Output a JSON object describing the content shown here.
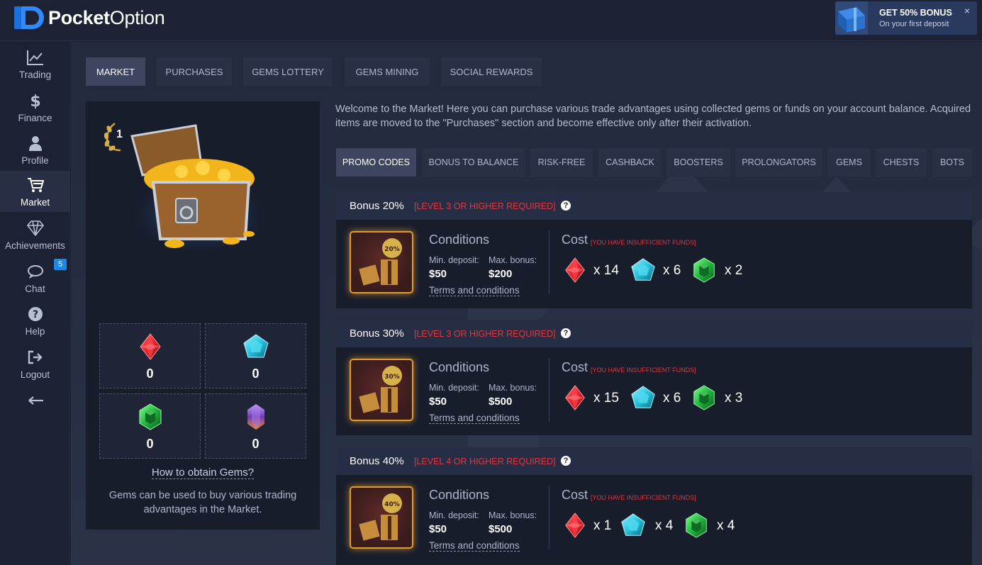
{
  "header": {
    "logo_bold": "Pocket",
    "logo_thin": "Option",
    "bonus_title": "GET 50% BONUS",
    "bonus_subtitle": "On your first deposit",
    "bonus_close": "×"
  },
  "sidebar": {
    "items": [
      {
        "label": "Trading",
        "icon": "chart-icon"
      },
      {
        "label": "Finance",
        "icon": "dollar-icon"
      },
      {
        "label": "Profile",
        "icon": "user-icon"
      },
      {
        "label": "Market",
        "icon": "cart-icon",
        "active": true
      },
      {
        "label": "Achievements",
        "icon": "diamond-icon"
      },
      {
        "label": "Chat",
        "icon": "chat-icon",
        "badge": "5"
      },
      {
        "label": "Help",
        "icon": "question-icon"
      },
      {
        "label": "Logout",
        "icon": "logout-icon"
      }
    ],
    "collapse_arrow": "⟵"
  },
  "top_tabs": [
    "MARKET",
    "PURCHASES",
    "GEMS LOTTERY",
    "GEMS MINING",
    "SOCIAL REWARDS"
  ],
  "left_panel": {
    "level": "1",
    "gems": [
      {
        "type": "red-gem",
        "count": "0"
      },
      {
        "type": "blue-gem",
        "count": "0"
      },
      {
        "type": "green-gem",
        "count": "0"
      },
      {
        "type": "purple-gem",
        "count": "0"
      }
    ],
    "obtain_link": "How to obtain Gems?",
    "description": "Gems can be used to buy various trading advantages in the Market."
  },
  "welcome_text": "Welcome to the Market! Here you can purchase various trade advantages using collected gems or funds on your account balance. Acquired items are moved to the \"Purchases\" section and become effective only after their activation.",
  "sub_tabs": [
    "PROMO CODES",
    "BONUS TO BALANCE",
    "RISK-FREE",
    "CASHBACK",
    "BOOSTERS",
    "PROLONGATORS",
    "GEMS",
    "CHESTS",
    "BOTS"
  ],
  "offers": [
    {
      "title": "Bonus 20%",
      "requirement": "[LEVEL 3 OR HIGHER REQUIRED]",
      "badge": "20%",
      "conditions_title": "Conditions",
      "min_deposit_label": "Min. deposit:",
      "min_deposit": "$50",
      "max_bonus_label": "Max. bonus:",
      "max_bonus": "$200",
      "terms": "Terms and conditions",
      "cost_title": "Cost",
      "cost_warning": "[YOU HAVE INSUFFICIENT FUNDS]",
      "costs": [
        "x 14",
        "x 6",
        "x 2"
      ]
    },
    {
      "title": "Bonus 30%",
      "requirement": "[LEVEL 3 OR HIGHER REQUIRED]",
      "badge": "30%",
      "conditions_title": "Conditions",
      "min_deposit_label": "Min. deposit:",
      "min_deposit": "$50",
      "max_bonus_label": "Max. bonus:",
      "max_bonus": "$500",
      "terms": "Terms and conditions",
      "cost_title": "Cost",
      "cost_warning": "[YOU HAVE INSUFFICIENT FUNDS]",
      "costs": [
        "x 15",
        "x 6",
        "x 3"
      ]
    },
    {
      "title": "Bonus 40%",
      "requirement": "[LEVEL 4 OR HIGHER REQUIRED]",
      "badge": "40%",
      "conditions_title": "Conditions",
      "min_deposit_label": "Min. deposit:",
      "min_deposit": "$50",
      "max_bonus_label": "Max. bonus:",
      "max_bonus": "$500",
      "terms": "Terms and conditions",
      "cost_title": "Cost",
      "cost_warning": "[YOU HAVE INSUFFICIENT FUNDS]",
      "costs": [
        "x 1",
        "x 4",
        "x 4"
      ]
    }
  ],
  "colors": {
    "accent_blue": "#1e88e5",
    "warning_red": "#e0363f",
    "gem_red": "#e5202c",
    "gem_blue": "#27c4e0",
    "gem_green": "#22b53e",
    "gem_purple": "#8a4fd1"
  }
}
